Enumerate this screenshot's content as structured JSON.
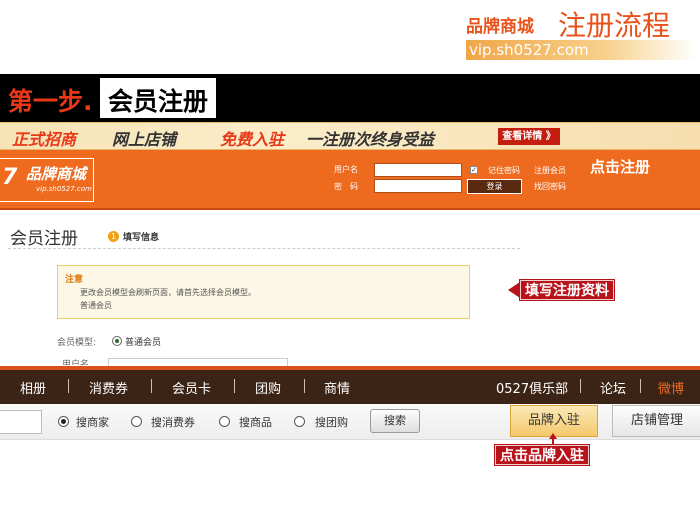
{
  "header": {
    "brand": "品牌商城",
    "flow_title": "注册流程",
    "url": "vip.sh0527.com"
  },
  "banner": {
    "step": "第一步.",
    "title": "会员注册"
  },
  "promo": {
    "items": [
      "正式招商",
      "网上店铺",
      "免费入驻",
      "一注册次终身受益"
    ],
    "detail_button": "查看详情 》",
    "colors": {
      "primary": "#e83818",
      "dark": "#333333"
    }
  },
  "login_bar": {
    "logo_number": "7",
    "logo_name": "品牌商城",
    "logo_url": "vip.sh0527.com",
    "username_label": "用户名",
    "password_label": "密　码",
    "remember_label": "记住密码",
    "login_button": "登录",
    "register_link": "注册会员",
    "forgot_link": "找回密码",
    "click_register": "点击注册",
    "background_color": "#ee6a1f"
  },
  "register": {
    "title": "会员注册",
    "step_number": "1",
    "step_text": "填写信息",
    "notice_title": "注意",
    "notice_text": "更改会员模型会刷新页面，请首先选择会员模型。",
    "notice_model": "普通会员",
    "fill_info_tag": "填写注册资料",
    "member_model_label": "会员模型:",
    "member_model_value": "普通会员",
    "username_label": "用户名"
  },
  "nav": {
    "items": [
      "相册",
      "消费券",
      "会员卡",
      "团购",
      "商情",
      "0527俱乐部",
      "论坛",
      "微博"
    ]
  },
  "search": {
    "radios": [
      "搜商家",
      "搜消费券",
      "搜商品",
      "搜团购"
    ],
    "selected": "搜商家",
    "button": "搜索",
    "brand_join": "品牌入驻",
    "shop_manage": "店铺管理",
    "click_brand_tag": "点击品牌入驻"
  }
}
